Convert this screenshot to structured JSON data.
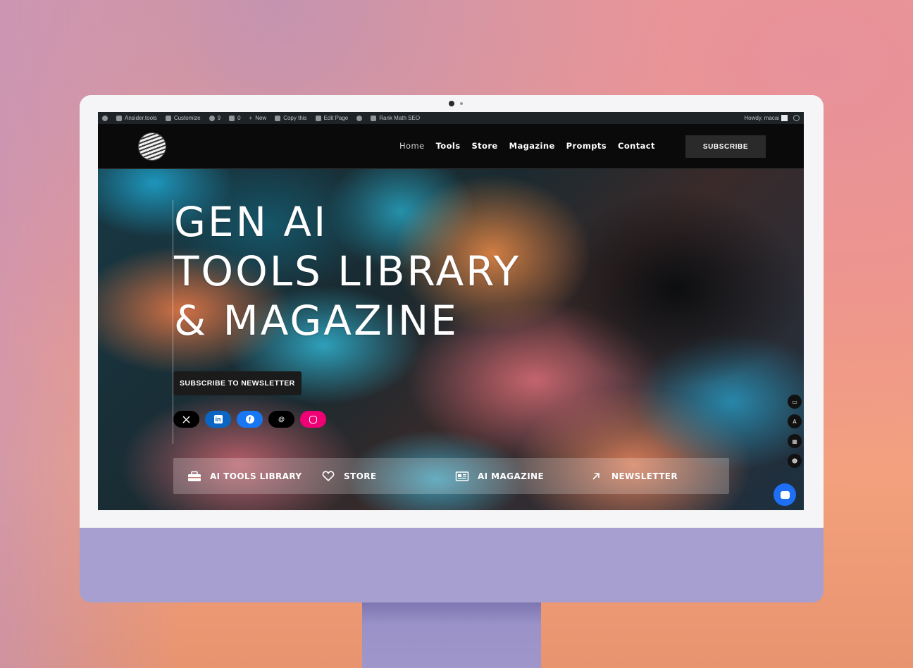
{
  "admin_bar": {
    "site": "Ansider.tools",
    "customize": "Customize",
    "updates": "9",
    "comments": "0",
    "new": "New",
    "copy": "Copy this",
    "edit": "Edit Page",
    "rankmath": "Rank Math SEO",
    "howdy": "Howdy, macai"
  },
  "nav": {
    "items": [
      "Home",
      "Tools",
      "Store",
      "Magazine",
      "Prompts",
      "Contact"
    ],
    "subscribe": "SUBSCRIBE"
  },
  "hero": {
    "title_lines": [
      "GEN AI",
      "TOOLS LIBRARY",
      "& MAGAZINE"
    ],
    "cta": "SUBSCRIBE TO NEWSLETTER",
    "socials": [
      "x-icon",
      "linkedin-icon",
      "facebook-icon",
      "threads-icon",
      "instagram-icon"
    ]
  },
  "quick_links": [
    {
      "label": "AI TOOLS LIBRARY",
      "icon": "toolbox-icon"
    },
    {
      "label": "STORE",
      "icon": "heart-icon"
    },
    {
      "label": "AI MAGAZINE",
      "icon": "newspaper-icon"
    },
    {
      "label": "NEWSLETTER",
      "icon": "arrow-up-right-icon"
    }
  ],
  "colors": {
    "linkedin": "#0a66c2",
    "facebook": "#1877f2",
    "instagram": "#f00075",
    "chat": "#1e6ff5",
    "monitor_chin": "#a79fcf"
  }
}
